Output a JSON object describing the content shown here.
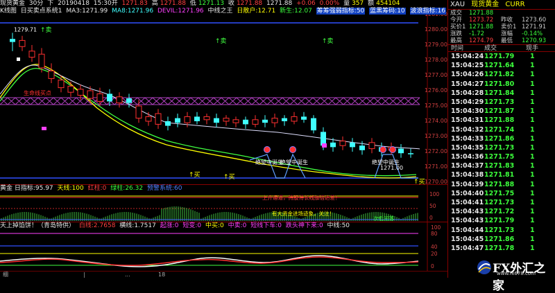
{
  "header": {
    "symbol": "现货黄金",
    "period": "30分",
    "direction": "下",
    "date": "20190418",
    "time": "15:30开",
    "open": "1271.83",
    "high_label": "高",
    "high": "1271.88",
    "low_label": "低",
    "low": "1271.13",
    "close_label": "收",
    "close": "1271.88",
    "change_label": "1271.88",
    "change": "+0.06",
    "change_pct": "0.00%",
    "qty_label": "量",
    "qty": "357",
    "amount_label": "额",
    "amount": "454104"
  },
  "main_legend": {
    "kline": "K线图",
    "system": "日买卖点系统1",
    "ma3": "MA3:1271.99",
    "ma8": "MA8:1271.96",
    "devil": "DEVIL:1271.96",
    "midline": "中线之王",
    "buy": "日散户:12.71",
    "newline": "新生:12.07",
    "tag1": "筹筹强弱指标:50",
    "tag2": "蓝黑筹码:10",
    "tag3": "波浪指标:16"
  },
  "price_axis": [
    "1281.00",
    "1280.00",
    "1279.00",
    "1278.00",
    "1277.00",
    "1276.00",
    "1275.00",
    "1274.00",
    "1273.00",
    "1272.00",
    "1271.00",
    "1270.00"
  ],
  "annotations": {
    "high_price": "1279.71",
    "low_price": "1271.00",
    "signal1": "绝望中诞生",
    "signal2": "绝望中诞生",
    "signal3": "绝望中诞生",
    "buy_mark": "↑买",
    "sell_mark": "↑卖",
    "left_text": "生命线买点",
    "sub1_text1": "上升通道，持股待长线加倍达差！",
    "sub1_text2": "有大资金进场迹象，关注！",
    "sub1_text3": "次低回落"
  },
  "sub1_legend": {
    "name": "黄金 日指标:95.97",
    "sky": "天线:100",
    "tp": "红柱:0",
    "gp": "绿柱:26.32",
    "warn": "预警系统:60"
  },
  "sub2_legend": {
    "name": "天上掉馅饼！（青岛特供）",
    "a": "白线:2.7658",
    "b": "横线:1.7517",
    "c": "起涨:0",
    "d": "短变:0",
    "e": "中买:0",
    "f": "中卖:0",
    "g": "短线下车:0",
    "h": "跌头神下来:0",
    "i": "中线:50"
  },
  "sub_axis1": [
    "100",
    "50",
    "0"
  ],
  "sub_axis2": [
    "100",
    "80",
    "40",
    "20",
    "0"
  ],
  "bottom_tabs": [
    "细",
    "|",
    "...",
    "18"
  ],
  "quote": {
    "code": "XAU",
    "name": "现货黄金",
    "market": "CURR",
    "rows": [
      {
        "l1": "成交",
        "v1": "1271.88",
        "l2": "",
        "v2": ""
      },
      {
        "l1": "今开",
        "v1": "1273.72",
        "l2": "昨收",
        "v2": "1273.60"
      },
      {
        "l1": "买价1",
        "v1": "1271.88",
        "l2": "卖价1",
        "v2": "1271.91"
      },
      {
        "l1": "涨跌",
        "v1": "-1.72",
        "l2": "涨幅",
        "v2": "-0.14%"
      },
      {
        "l1": "最高",
        "v1": "1274.79",
        "l2": "最低",
        "v2": "1270.93"
      }
    ]
  },
  "ticks_header": {
    "time": "时间",
    "price": "成交",
    "vol": "现手"
  },
  "ticks": [
    {
      "time": "15:04:24",
      "price": "1271.79",
      "vol": "1"
    },
    {
      "time": "15:04:25",
      "price": "1271.64",
      "vol": "1"
    },
    {
      "time": "15:04:26",
      "price": "1271.82",
      "vol": "1"
    },
    {
      "time": "15:04:27",
      "price": "1271.80",
      "vol": "1"
    },
    {
      "time": "15:04:28",
      "price": "1271.84",
      "vol": "1"
    },
    {
      "time": "15:04:29",
      "price": "1271.73",
      "vol": "1"
    },
    {
      "time": "15:04:30",
      "price": "1271.87",
      "vol": "1"
    },
    {
      "time": "15:04:31",
      "price": "1271.88",
      "vol": "1"
    },
    {
      "time": "15:04:32",
      "price": "1271.74",
      "vol": "1"
    },
    {
      "time": "15:04:33",
      "price": "1271.86",
      "vol": "1"
    },
    {
      "time": "15:04:35",
      "price": "1271.73",
      "vol": "1"
    },
    {
      "time": "15:04:36",
      "price": "1271.75",
      "vol": "1"
    },
    {
      "time": "15:04:37",
      "price": "1271.83",
      "vol": "1"
    },
    {
      "time": "15:04:38",
      "price": "1271.81",
      "vol": "1"
    },
    {
      "time": "15:04:39",
      "price": "1271.88",
      "vol": "1"
    },
    {
      "time": "15:04:40",
      "price": "1271.75",
      "vol": "1"
    },
    {
      "time": "15:04:41",
      "price": "1271.73",
      "vol": "1"
    },
    {
      "time": "15:04:43",
      "price": "1271.72",
      "vol": "1"
    },
    {
      "time": "15:04:43",
      "price": "1271.79",
      "vol": "1"
    },
    {
      "time": "15:04:44",
      "price": "1271.73",
      "vol": "1"
    },
    {
      "time": "15:04:45",
      "price": "1271.86",
      "vol": "1"
    },
    {
      "time": "15:04:47",
      "price": "1271.78",
      "vol": "1"
    }
  ],
  "watermark": {
    "big": "FX外汇之家",
    "small": "www.fx678.com"
  },
  "colors": {
    "up": "#ff3030",
    "down": "#40ffff",
    "ma_yellow": "#ffff00",
    "ma_green": "#40ff40",
    "ma_white": "#ffffff",
    "purple": "#c040c0",
    "grid_red": "#a00000"
  }
}
